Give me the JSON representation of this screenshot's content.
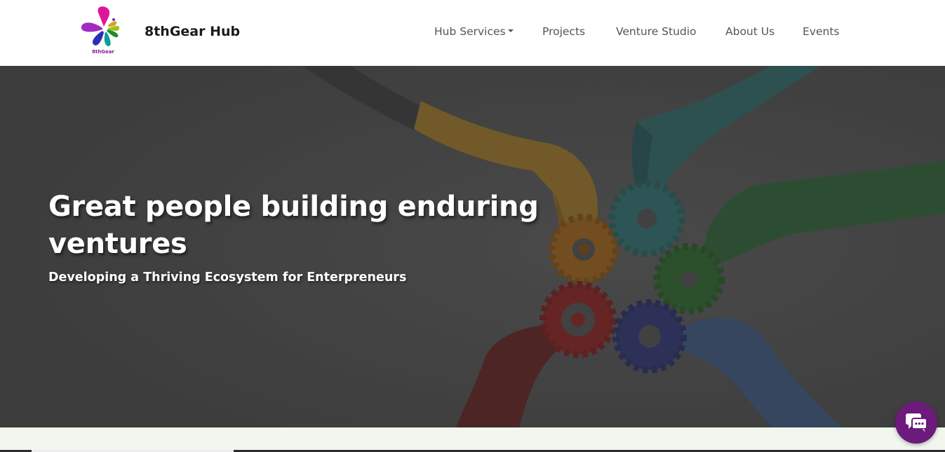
{
  "header": {
    "logo_text": "8thGear",
    "brand": "8thGear Hub"
  },
  "nav": {
    "items": [
      {
        "label": "Hub Services",
        "has_dropdown": true
      },
      {
        "label": "Projects"
      },
      {
        "label": "Venture Studio"
      },
      {
        "label": "About Us"
      },
      {
        "label": "Events"
      }
    ]
  },
  "hero": {
    "title": "Great people building enduring ventures",
    "subtitle": "Developing a Thriving Ecosystem for Enterpreneurs"
  },
  "chat": {
    "icon": "chat-bubbles-icon"
  },
  "colors": {
    "chat_bg": "#6c1a7c",
    "hero_overlay": "#4a4a4a",
    "strip": "#f1f7ef"
  }
}
